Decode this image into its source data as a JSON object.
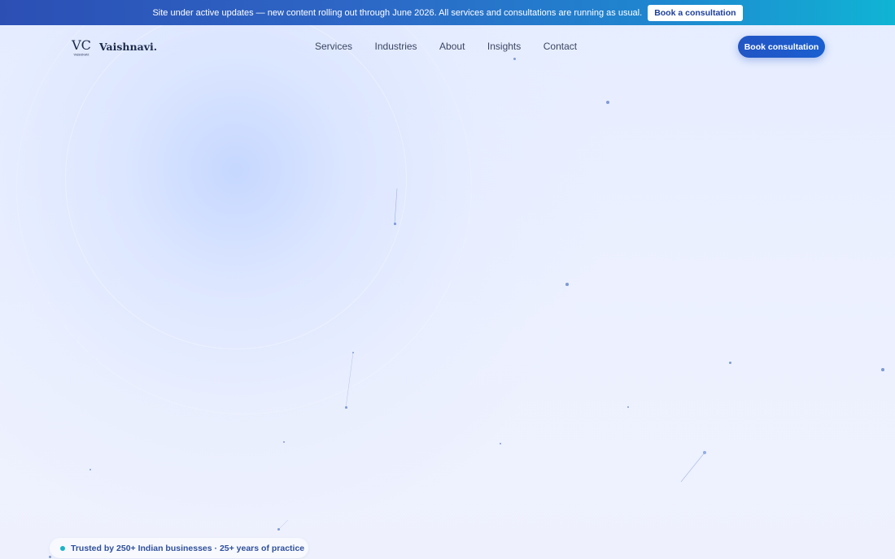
{
  "banner": {
    "message": "Site under active updates — new content rolling out through June 2026. All services and consultations are running as usual.",
    "button_label": "Book a consultation"
  },
  "header": {
    "logo_mark_text": "VC",
    "logo_subtext": "VAISHNAVI",
    "brand_name": "Vaishnavi.",
    "nav": [
      "Services",
      "Industries",
      "About",
      "Insights",
      "Contact"
    ],
    "cta_label": "Book consultation"
  },
  "trust_badge": {
    "text": "Trusted by 250+ Indian businesses · 25+ years of practice"
  },
  "colors": {
    "banner_start": "#2c4fb4",
    "banner_end": "#10b4d4",
    "cta": "#2255c4",
    "trust_dot": "#19b3c7",
    "background": "#e9efff"
  }
}
